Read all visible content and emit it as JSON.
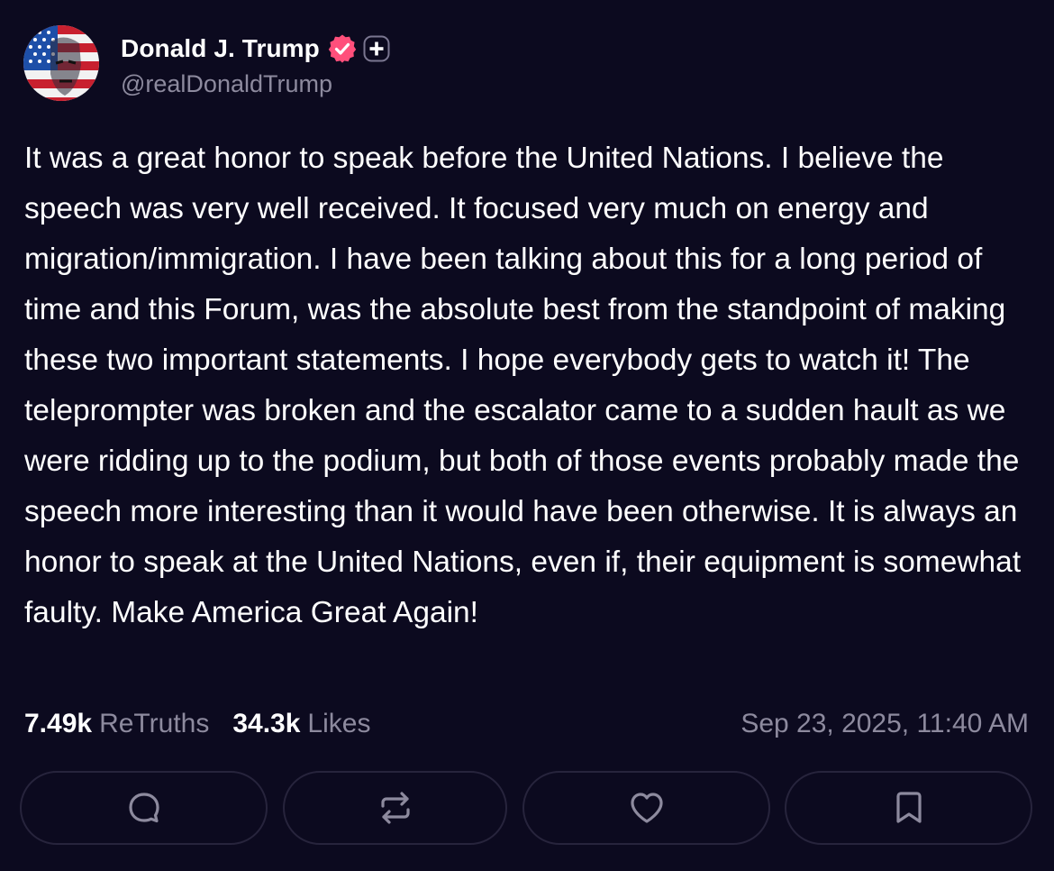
{
  "post": {
    "author": {
      "display_name": "Donald J. Trump",
      "handle": "@realDonaldTrump",
      "verified_icon": "verified-badge-icon",
      "plus_icon": "plus-badge-icon"
    },
    "text": "It was a great honor to speak before the United Nations. I believe the speech was very well received. It focused very much on energy and migration/immigration. I have been talking about this for a long period of time and this Forum, was the absolute best from the standpoint of making these two important statements. I hope everybody gets to watch it! The teleprompter was broken and the escalator came to a sudden hault as we were ridding up to the podium, but both of those events probably made the speech more interesting than it would have been otherwise. It is always an honor to speak at the United Nations, even if, their equipment is somewhat faulty. Make America Great Again!",
    "stats": {
      "retruths_count": "7.49k",
      "retruths_label": "ReTruths",
      "likes_count": "34.3k",
      "likes_label": "Likes"
    },
    "timestamp": "Sep 23, 2025, 11:40 AM",
    "actions": [
      {
        "name": "reply-button",
        "icon": "comment-icon"
      },
      {
        "name": "retruth-button",
        "icon": "repost-icon"
      },
      {
        "name": "like-button",
        "icon": "heart-icon"
      },
      {
        "name": "bookmark-button",
        "icon": "bookmark-icon"
      }
    ]
  },
  "colors": {
    "background": "#0c0a1f",
    "text": "#ffffff",
    "muted": "#8d8a9e",
    "verified": "#ff4f7b",
    "button_border": "#27243c"
  }
}
